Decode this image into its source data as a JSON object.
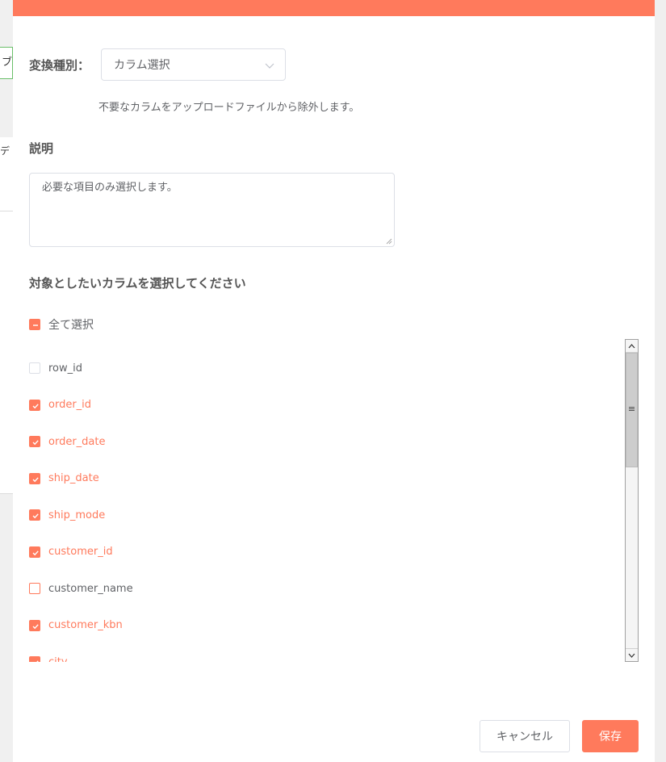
{
  "background": {
    "fragment_1": "ブ",
    "fragment_2": "デ"
  },
  "form": {
    "type_label": "変換種別：",
    "type_value": "カラム選択",
    "type_description": "不要なカラムをアップロードファイルから除外します。",
    "description_label": "説明",
    "description_value": "必要な項目のみ選択します。",
    "columns_heading": "対象としたいカラムを選択してください",
    "select_all_label": "全て選択",
    "select_all_state": "partial"
  },
  "columns": [
    {
      "name": "row_id",
      "checked": false
    },
    {
      "name": "order_id",
      "checked": true
    },
    {
      "name": "order_date",
      "checked": true
    },
    {
      "name": "ship_date",
      "checked": true
    },
    {
      "name": "ship_mode",
      "checked": true
    },
    {
      "name": "customer_id",
      "checked": true
    },
    {
      "name": "customer_name",
      "checked": false
    },
    {
      "name": "customer_kbn",
      "checked": true
    },
    {
      "name": "city",
      "checked": true
    }
  ],
  "buttons": {
    "cancel": "キャンセル",
    "save": "保存"
  },
  "colors": {
    "accent": "#ff7a5c",
    "text": "#606266",
    "border": "#dcdfe6"
  }
}
